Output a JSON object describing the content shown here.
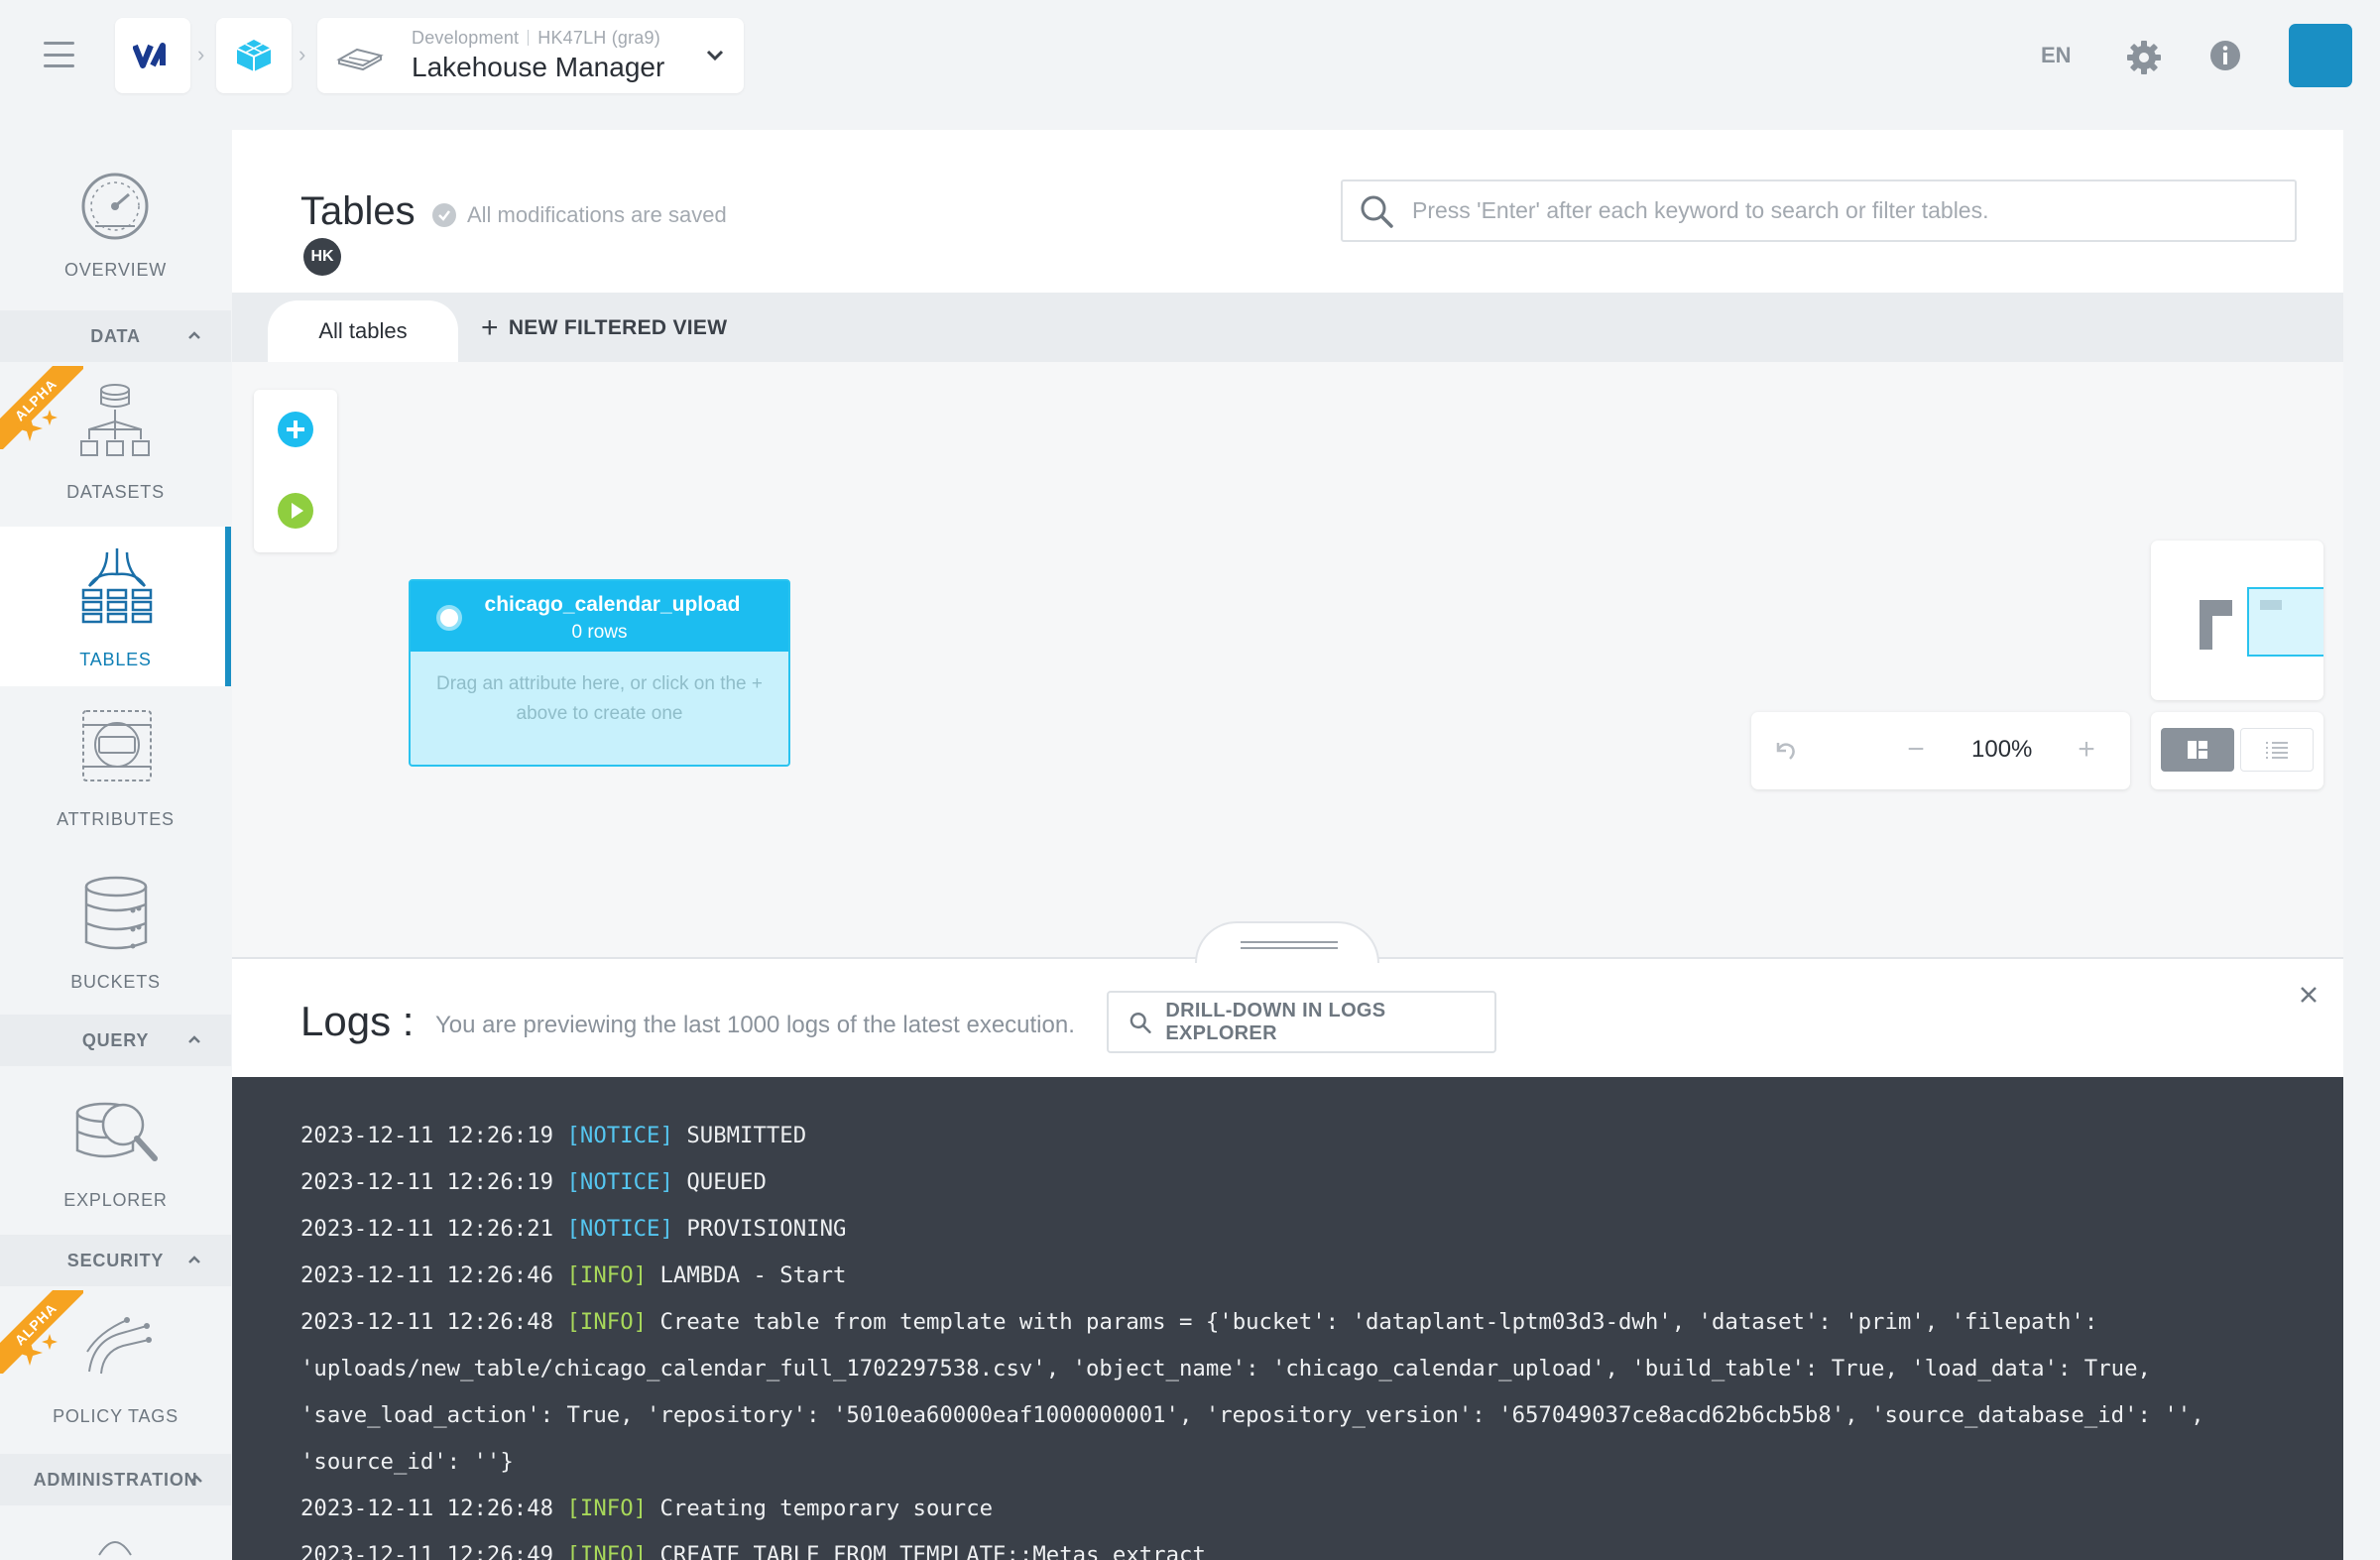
{
  "header": {
    "environment": "Development",
    "project_id": "HK47LH (gra9)",
    "project_name": "Lakehouse Manager",
    "language": "EN"
  },
  "sidebar": {
    "overview": "OVERVIEW",
    "sections": {
      "data": "DATA",
      "query": "QUERY",
      "security": "SECURITY",
      "administration": "ADMINISTRATION"
    },
    "items": {
      "datasets": "DATASETS",
      "tables": "TABLES",
      "attributes": "ATTRIBUTES",
      "buckets": "BUCKETS",
      "explorer": "EXPLORER",
      "policy_tags": "POLICY TAGS"
    },
    "alpha_badge": "ALPHA",
    "active_item": "tables"
  },
  "page": {
    "title": "Tables",
    "saved_status": "All modifications are saved",
    "user_initials": "HK",
    "search_placeholder": "Press 'Enter' after each keyword to search or filter tables."
  },
  "tabs": {
    "all_tables": "All tables",
    "new_filtered_view": "NEW FILTERED VIEW"
  },
  "canvas": {
    "table_node": {
      "name": "chicago_calendar_upload",
      "rows": "0 rows",
      "hint": "Drag an attribute here, or click on the + above to create one"
    },
    "zoom": "100%"
  },
  "logs": {
    "title": "Logs :",
    "subtitle": "You are previewing the last 1000 logs of the latest execution.",
    "drill_button": "DRILL-DOWN IN LOGS EXPLORER",
    "lines": [
      {
        "ts": "2023-12-11 12:26:19",
        "level": "[NOTICE]",
        "level_type": "notice",
        "msg": "SUBMITTED"
      },
      {
        "ts": "2023-12-11 12:26:19",
        "level": "[NOTICE]",
        "level_type": "notice",
        "msg": "QUEUED"
      },
      {
        "ts": "2023-12-11 12:26:21",
        "level": "[NOTICE]",
        "level_type": "notice",
        "msg": "PROVISIONING"
      },
      {
        "ts": "2023-12-11 12:26:46",
        "level": "[INFO]",
        "level_type": "info",
        "msg": "LAMBDA - Start"
      },
      {
        "ts": "2023-12-11 12:26:48",
        "level": "[INFO]",
        "level_type": "info",
        "msg": "Create table from template with params = {'bucket': 'dataplant-lptm03d3-dwh', 'dataset': 'prim', 'filepath':"
      },
      {
        "ts": "",
        "level": "",
        "level_type": "none",
        "msg": "'uploads/new_table/chicago_calendar_full_1702297538.csv', 'object_name': 'chicago_calendar_upload', 'build_table': True, 'load_data': True,"
      },
      {
        "ts": "",
        "level": "",
        "level_type": "none",
        "msg": "'save_load_action': True, 'repository': '5010ea60000eaf1000000001', 'repository_version': '657049037ce8acd62b6cb5b8', 'source_database_id': '',"
      },
      {
        "ts": "",
        "level": "",
        "level_type": "none",
        "msg": "'source_id': ''}"
      },
      {
        "ts": "2023-12-11 12:26:48",
        "level": "[INFO]",
        "level_type": "info",
        "msg": "Creating temporary source"
      },
      {
        "ts": "2023-12-11 12:26:49",
        "level": "[INFO]",
        "level_type": "info",
        "msg": "CREATE_TABLE_FROM_TEMPLATE::Metas extract"
      }
    ]
  },
  "colors": {
    "accent": "#1a8fc4",
    "node": "#1cbdf0",
    "notice": "#55c6f0",
    "info": "#a8d85a",
    "alpha": "#f6a321"
  }
}
